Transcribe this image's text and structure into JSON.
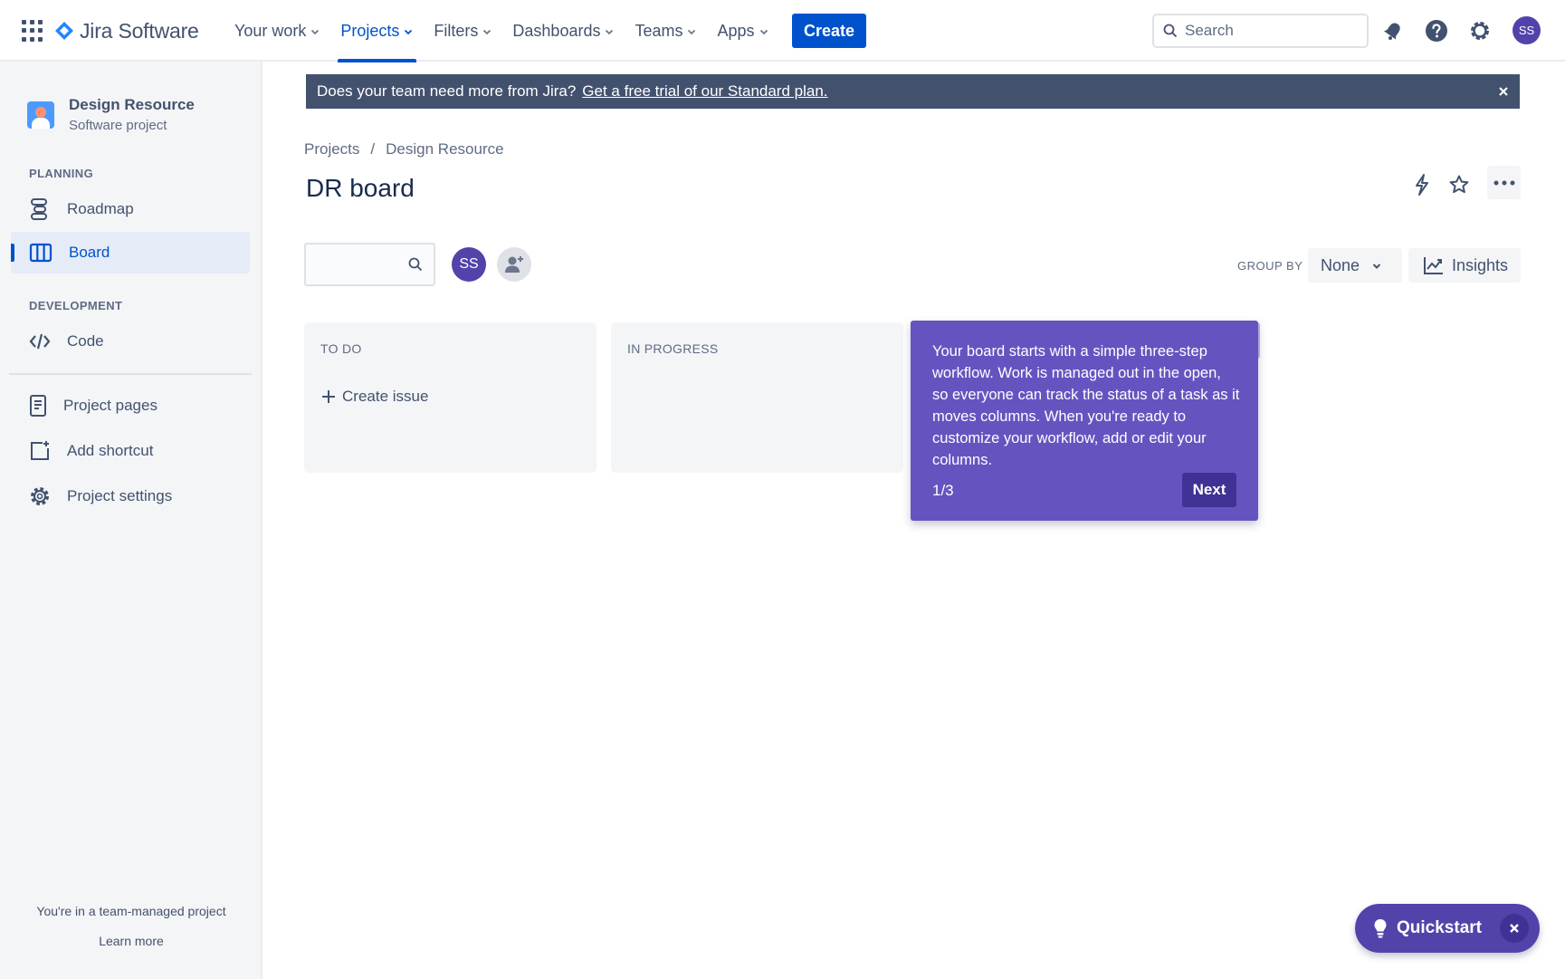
{
  "topnav": {
    "logo_text": "Jira Software",
    "items": [
      {
        "label": "Your work"
      },
      {
        "label": "Projects"
      },
      {
        "label": "Filters"
      },
      {
        "label": "Dashboards"
      },
      {
        "label": "Teams"
      },
      {
        "label": "Apps"
      }
    ],
    "active_item": "Projects",
    "create_label": "Create",
    "search_placeholder": "Search",
    "avatar_initials": "SS"
  },
  "sidebar": {
    "project_name": "Design Resource",
    "project_type": "Software project",
    "planning_label": "PLANNING",
    "development_label": "DEVELOPMENT",
    "items": [
      {
        "label": "Roadmap",
        "icon": "roadmap-icon"
      },
      {
        "label": "Board",
        "icon": "board-icon",
        "active": true
      },
      {
        "label": "Code",
        "icon": "code-icon"
      },
      {
        "label": "Project pages",
        "icon": "page-icon"
      },
      {
        "label": "Add shortcut",
        "icon": "add-shortcut-icon"
      },
      {
        "label": "Project settings",
        "icon": "gear-icon"
      }
    ],
    "footer_text": "You're in a team-managed project",
    "footer_link": "Learn more"
  },
  "banner": {
    "text": "Does your team need more from Jira?",
    "link": "Get a free trial of our Standard plan."
  },
  "breadcrumb": [
    "Projects",
    "Design Resource"
  ],
  "page_title": "DR board",
  "board": {
    "avatar_initials": "SS",
    "group_by_label": "GROUP BY",
    "group_by_value": "None",
    "insights_label": "Insights",
    "columns": [
      {
        "title": "TO DO",
        "create_label": "Create issue"
      },
      {
        "title": "IN PROGRESS"
      }
    ]
  },
  "tour": {
    "text": "Your board starts with a simple three-step workflow. Work is managed out in the open, so everyone can track the status of a task as it moves columns. When you're ready to customize your workflow, add or edit your columns.",
    "step": "1/3",
    "next_label": "Next"
  },
  "quickstart": {
    "label": "Quickstart"
  },
  "colors": {
    "brand_blue": "#0052cc",
    "banner_bg": "#42526e",
    "tour_bg": "#6554c0",
    "quickstart_bg": "#5243aa"
  }
}
